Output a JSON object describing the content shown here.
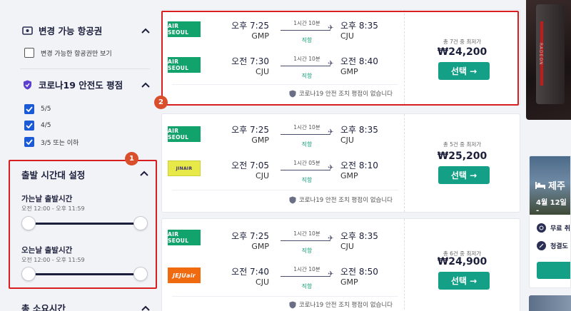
{
  "sidebar": {
    "changeable": {
      "title": "변경 가능 항공권",
      "option": "변경 가능한 항공권만 보기"
    },
    "covid": {
      "title": "코로나19 안전도 평점",
      "options": [
        "5/5",
        "4/5",
        "3/5 또는 이하"
      ]
    },
    "time": {
      "title": "출발 시간대 설정",
      "outbound": {
        "label": "가는날 출발시간",
        "range": "오전 12:00 - 오후 11:59"
      },
      "inbound": {
        "label": "오는날 출발시간",
        "range": "오전 12:00 - 오후 11:59"
      }
    },
    "duration": {
      "title": "총 소요시간"
    }
  },
  "annotations": {
    "one": "1",
    "two": "2"
  },
  "flights": [
    {
      "note": "총 7건 중 최저가",
      "price": "₩24,200",
      "covid_note": "코로나19 안전 조치 평점이 없습니다",
      "legs": [
        {
          "airline": "AIR SEOUL",
          "dep_time": "오후 7:25",
          "dep_ap": "GMP",
          "arr_time": "오후 8:35",
          "arr_ap": "CJU",
          "duration": "1시간 10분",
          "stops": "직항"
        },
        {
          "airline": "AIR SEOUL",
          "dep_time": "오전 7:30",
          "dep_ap": "CJU",
          "arr_time": "오전 8:40",
          "arr_ap": "GMP",
          "duration": "1시간 10분",
          "stops": "직항"
        }
      ]
    },
    {
      "note": "총 5건 중 최저가",
      "price": "₩25,200",
      "covid_note": "코로나19 안전 조치 평점이 없습니다",
      "legs": [
        {
          "airline": "AIR SEOUL",
          "dep_time": "오후 7:25",
          "dep_ap": "GMP",
          "arr_time": "오후 8:35",
          "arr_ap": "CJU",
          "duration": "1시간 10분",
          "stops": "직항"
        },
        {
          "airline": "JINAIR",
          "dep_time": "오전 7:05",
          "dep_ap": "CJU",
          "arr_time": "오전 8:10",
          "arr_ap": "GMP",
          "duration": "1시간 05분",
          "stops": "직항"
        }
      ]
    },
    {
      "note": "총 6건 중 최저가",
      "price": "₩24,900",
      "covid_note": "코로나19 안전 조치 평점이 없습니다",
      "legs": [
        {
          "airline": "AIR SEOUL",
          "dep_time": "오후 7:25",
          "dep_ap": "GMP",
          "arr_time": "오후 8:35",
          "arr_ap": "CJU",
          "duration": "1시간 10분",
          "stops": "직항"
        },
        {
          "airline": "JEJUair",
          "dep_time": "오전 7:40",
          "dep_ap": "CJU",
          "arr_time": "오전 8:50",
          "arr_ap": "GMP",
          "duration": "1시간 10분",
          "stops": "직항"
        }
      ]
    }
  ],
  "select_label": "선택 →",
  "side": {
    "ad_text": "RADEON",
    "hotel_name": "제주",
    "hotel_date": "4월 12일 -",
    "perk1": "무료 취",
    "perk2": "청결도"
  },
  "colors": {
    "accent": "#13a086",
    "highlight": "#d81e1e",
    "check": "#1a5ad7"
  }
}
